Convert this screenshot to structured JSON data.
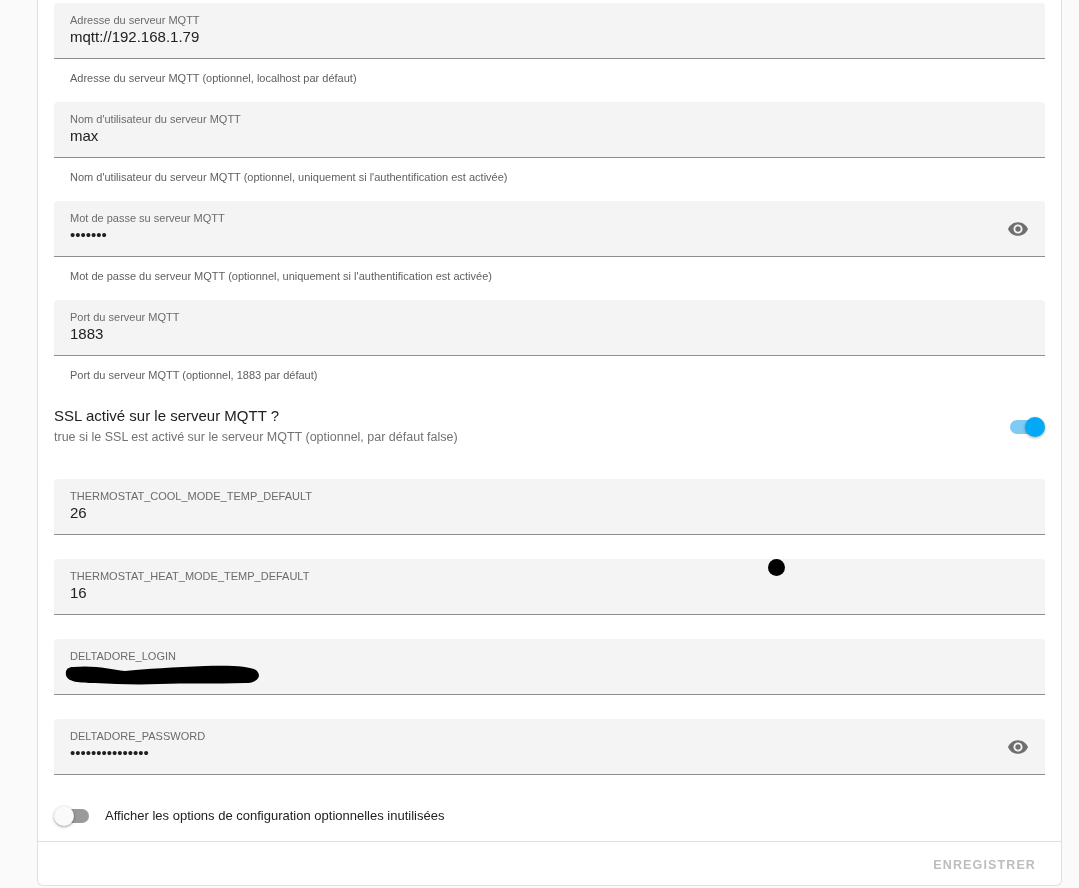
{
  "items": [
    {
      "kind": "text",
      "label": "Adresse du serveur MQTT",
      "value": "mqtt://192.168.1.79",
      "helper": "Adresse du serveur MQTT (optionnel, localhost par défaut)"
    },
    {
      "kind": "text",
      "label": "Nom d'utilisateur du serveur MQTT",
      "value": "max",
      "helper": "Nom d'utilisateur du serveur MQTT (optionnel, uniquement si l'authentification est activée)"
    },
    {
      "kind": "password",
      "label": "Mot de passe su serveur MQTT",
      "value": "•••••••",
      "helper": "Mot de passe du serveur MQTT (optionnel, uniquement si l'authentification est activée)"
    },
    {
      "kind": "text",
      "label": "Port du serveur MQTT",
      "value": "1883",
      "helper": "Port du serveur MQTT (optionnel, 1883 par défaut)"
    },
    {
      "kind": "switch",
      "title": "SSL activé sur le serveur MQTT ?",
      "description": "true si le SSL est activé sur le serveur MQTT (optionnel, par défaut false)",
      "on": true
    },
    {
      "kind": "text",
      "label": "THERMOSTAT_COOL_MODE_TEMP_DEFAULT",
      "value": "26"
    },
    {
      "kind": "text",
      "label": "THERMOSTAT_HEAT_MODE_TEMP_DEFAULT",
      "value": "16"
    },
    {
      "kind": "text",
      "label": "DELTADORE_LOGIN",
      "redacted": true
    },
    {
      "kind": "password",
      "label": "DELTADORE_PASSWORD",
      "value": "•••••••••••••••"
    }
  ],
  "unused_options_toggle": {
    "label": "Afficher les options de configuration optionnelles inutilisées",
    "on": false
  },
  "save_button": {
    "label": "ENREGISTRER",
    "disabled": true
  }
}
